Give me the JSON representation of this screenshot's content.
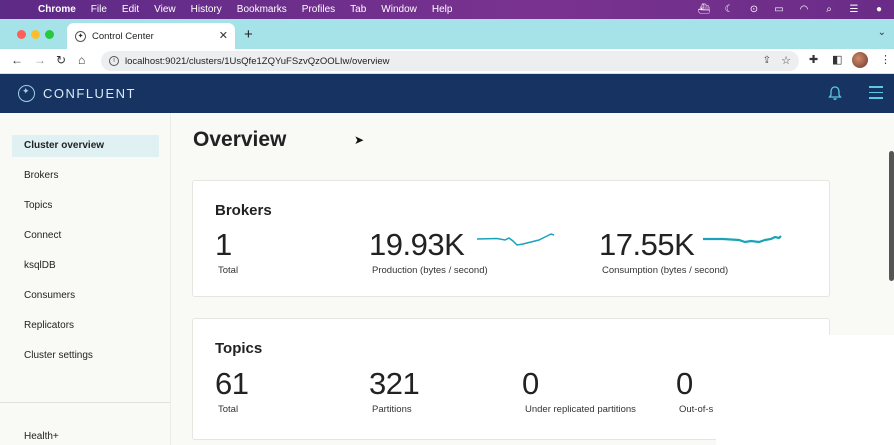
{
  "menubar": {
    "app": "Chrome",
    "items": [
      "File",
      "Edit",
      "View",
      "History",
      "Bookmarks",
      "Profiles",
      "Tab",
      "Window",
      "Help"
    ]
  },
  "browser": {
    "tab_title": "Control Center",
    "url": "localhost:9021/clusters/1UsQfe1ZQYuFSzvQzOOLIw/overview"
  },
  "app": {
    "logo_text": "CONFLUENT",
    "accent_color": "#5cc9e8",
    "header_color": "#173361"
  },
  "sidebar": {
    "items": [
      {
        "label": "Cluster overview",
        "active": true
      },
      {
        "label": "Brokers"
      },
      {
        "label": "Topics"
      },
      {
        "label": "Connect"
      },
      {
        "label": "ksqlDB"
      },
      {
        "label": "Consumers"
      },
      {
        "label": "Replicators"
      },
      {
        "label": "Cluster settings"
      }
    ],
    "bottom_item": "Health+"
  },
  "main": {
    "title": "Overview",
    "brokers": {
      "title": "Brokers",
      "total_value": "1",
      "total_label": "Total",
      "production_value": "19.93K",
      "production_label": "Production (bytes / second)",
      "consumption_value": "17.55K",
      "consumption_label": "Consumption (bytes / second)"
    },
    "topics": {
      "title": "Topics",
      "total_value": "61",
      "total_label": "Total",
      "partitions_value": "321",
      "partitions_label": "Partitions",
      "urp_value": "0",
      "urp_label": "Under replicated partitions",
      "oos_value": "0",
      "oos_label": "Out-of-s"
    }
  }
}
